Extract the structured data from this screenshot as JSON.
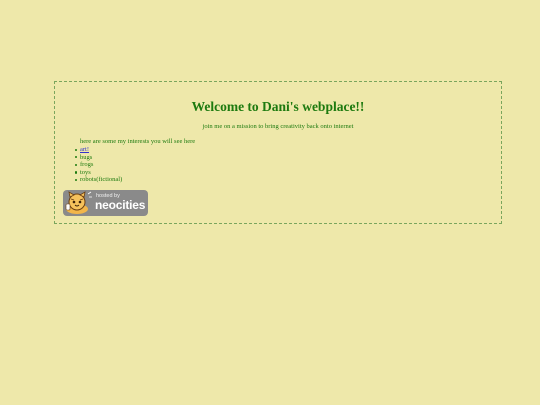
{
  "page": {
    "title": "Welcome to Dani's webplace!!",
    "subtitle": "join me on a mission to bring creativity back onto internet",
    "interests_intro": "here are some my interests you will see here"
  },
  "interests": [
    {
      "label": "art!",
      "is_link": true
    },
    {
      "label": "bugs",
      "is_link": false
    },
    {
      "label": "frogs",
      "is_link": false
    },
    {
      "label": "toys",
      "is_link": false
    },
    {
      "label": "robots(fictional)",
      "is_link": false
    }
  ],
  "badge": {
    "small_text": "hosted by",
    "big_text": "neocities",
    "icon": "neocities-cat-icon"
  },
  "colors": {
    "background": "#eee8aa",
    "text": "#1d7a0f",
    "link": "#3333cc",
    "border": "#7aa55d"
  }
}
